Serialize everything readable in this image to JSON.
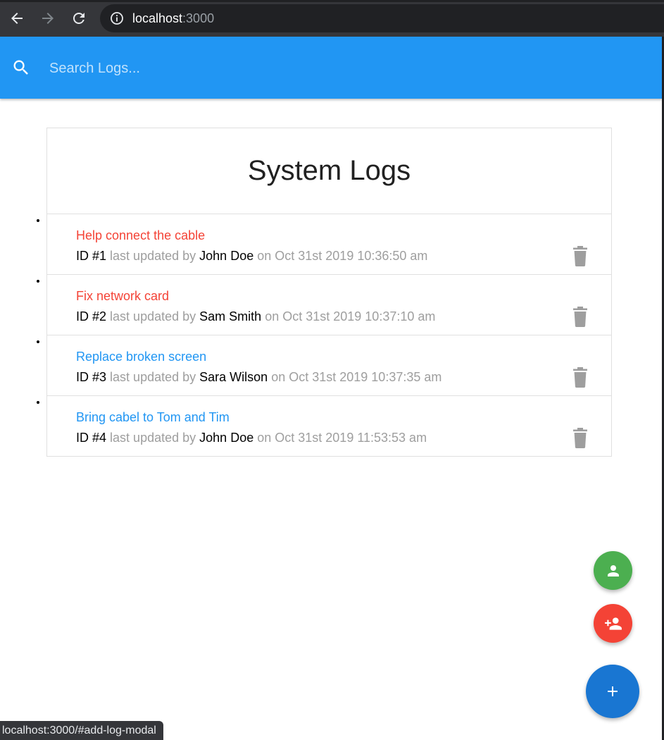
{
  "browser": {
    "url_host": "localhost",
    "url_port": ":3000",
    "status_url": "localhost:3000/#add-log-modal"
  },
  "navbar": {
    "search_placeholder": "Search Logs...",
    "search_icon": "search-icon",
    "color": "#2196f3"
  },
  "logs": {
    "title": "System Logs",
    "items": [
      {
        "message": "Help connect the cable",
        "attention": true,
        "id_label": "ID #1",
        "updated_text": "last updated by",
        "tech": "John Doe",
        "date_text": "on Oct 31st 2019 10:36:50 am"
      },
      {
        "message": "Fix network card",
        "attention": true,
        "id_label": "ID #2",
        "updated_text": "last updated by",
        "tech": "Sam Smith",
        "date_text": "on Oct 31st 2019 10:37:10 am"
      },
      {
        "message": "Replace broken screen",
        "attention": false,
        "id_label": "ID #3",
        "updated_text": "last updated by",
        "tech": "Sara Wilson",
        "date_text": "on Oct 31st 2019 10:37:35 am"
      },
      {
        "message": "Bring cabel to Tom and Tim",
        "attention": false,
        "id_label": "ID #4",
        "updated_text": "last updated by",
        "tech": "John Doe",
        "date_text": "on Oct 31st 2019 11:53:53 am"
      }
    ]
  },
  "fabs": {
    "tech_list_icon": "person-icon",
    "add_tech_icon": "person-add-icon",
    "add_log_icon": "plus-icon",
    "colors": {
      "tech_list": "#4caf50",
      "add_tech": "#f44336",
      "add_log": "#1976d2"
    }
  },
  "colors": {
    "attention": "#f44336",
    "normal": "#2196f3",
    "muted": "#9e9e9e"
  }
}
